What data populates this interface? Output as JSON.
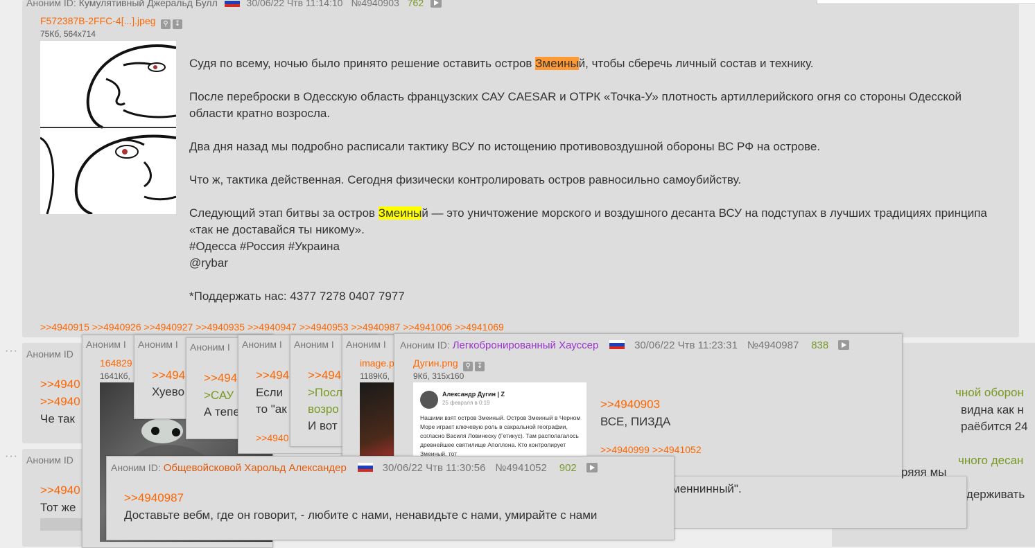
{
  "main_post": {
    "label": "Аноним ID:",
    "poster": "Кумулятивный Джеральд Булл",
    "date": "30/06/22 Чтв 11:14:10",
    "number": "№4940903",
    "rating": "762",
    "file_name": "F572387B-2FFC-4[...].jpeg",
    "file_meta": "75Кб, 564x714",
    "p1_before": "Судя по всему, ночью было принято решение оставить остров ",
    "p1_mark": "Змеины",
    "p1_after": "й, чтобы сберечь личный состав и технику.",
    "p2": "После переброски в Одесскую область французских САУ CAESAR и ОТРК «Точка-У» плотность артиллерийского огня со стороны Одесской области кратно возросла.",
    "p3": "Два дня назад мы подробно расписали тактику ВСУ по истощению противовоздушной обороны ВС РФ на острове.",
    "p4": "Что ж, тактика действенная. Сегодня физически контролировать остров равносильно самоубийству.",
    "p5_before": "Следующий этап битвы за остров ",
    "p5_mark": "Змеины",
    "p5_after": "й — это уничтожение морского и воздушного десанта ВСУ на подступах в лучших традициях принципа «так не доставайся ты никому».",
    "tags": "#Одесса #Россия #Украина",
    "handle": "@rybar",
    "support": "*Поддержать нас: 4377 7278 0407 7977",
    "replies": ">>4940915 >>4940926 >>4940927 >>4940935 >>4940947 >>4940953 >>4940987 >>4941006 >>4941069"
  },
  "bg_post_1": {
    "label": "Аноним ID",
    "r1": ">>4940",
    "r2": ">>4940",
    "text": "Че так"
  },
  "bg_post_2": {
    "label": "Аноним ID",
    "r1": ">>4940",
    "text": "Тот же"
  },
  "right_fragments": {
    "f1": "чной оборон",
    "f2": "видна как н",
    "f3": "раёбится 24",
    "f4": "чного десан",
    "f5": "удерживать",
    "f6": "ряяя мы",
    "f7": "меннинный\"."
  },
  "stack": {
    "p1": {
      "label": "Аноним I",
      "file": "164829",
      "meta": "1641Кб,"
    },
    "p2": {
      "label": "Аноним I",
      "reply": ">>494",
      "text": "Хуево"
    },
    "p3": {
      "label": "Аноним I",
      "reply": ">>494",
      "green": ">САУ",
      "text": "А тепе"
    },
    "p4": {
      "label": "Аноним I",
      "reply": ">>494",
      "text1": "Если",
      "text2": "то \"ак",
      "reply2": ">>4940"
    },
    "p5": {
      "label": "Аноним I",
      "reply": ">>494",
      "green1": ">Посл",
      "green2": "возро",
      "text": "И вот"
    },
    "p6": {
      "label": "Аноним I",
      "file": "image.p",
      "meta": "1189Кб,"
    }
  },
  "popup_987": {
    "label": "Аноним ID:",
    "poster": "Легкобронированный Хауссер",
    "date": "30/06/22 Чтв 11:23:31",
    "number": "№4940987",
    "rating": "838",
    "file_name": "Дугин.png",
    "file_meta": "9Кб, 315x160",
    "reply": ">>4940903",
    "text": "ВСЕ, ПИЗДА",
    "replies": ">>4940999 >>4941052",
    "thumb_author": "Александр Дугин | Z",
    "thumb_date": "25 февраля в 0:19",
    "thumb_text": "Нашими взят остров Змеиный. Остров Змеиный в Черном Море играет ключевую роль в сакральной географии, согласно Василя Ловинеску (Гетикус). Там располагалось древнейшее святилище Аполлона. Кто контролирует Змеиный, тот"
  },
  "popup_1052": {
    "label": "Аноним ID:",
    "poster": "Общевойсковой Харольд Александер",
    "date": "30/06/22 Чтв 11:30:56",
    "number": "№4941052",
    "rating": "902",
    "reply": ">>4940987",
    "text": "Доставьте вебм, где он говорит, - любите с нами, ненавидьте с нами, умирайте с нами"
  },
  "colors": {
    "accent": "#ff6600",
    "greentext": "#789922",
    "purple": "#9933cc",
    "rating": "#7a9a2c"
  }
}
